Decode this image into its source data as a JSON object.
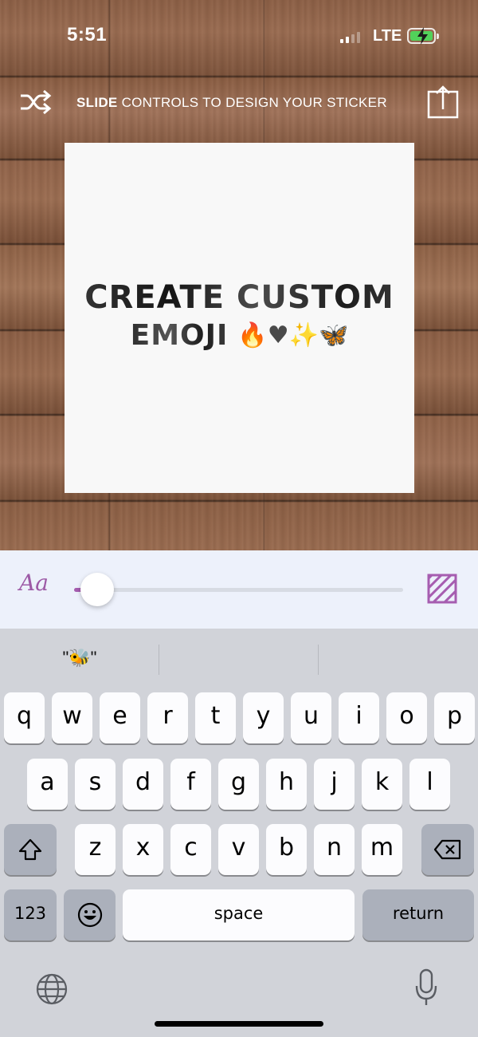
{
  "status_bar": {
    "time": "5:51",
    "network": "LTE",
    "battery_color": "#52d15a"
  },
  "top_bar": {
    "hint_bold": "SLIDE",
    "hint_rest": " CONTROLS TO DESIGN YOUR STICKER",
    "shuffle_icon": "shuffle-icon",
    "share_icon": "share-icon"
  },
  "sticker": {
    "line1": "CREATE CUSTOM",
    "line2": "EMOJI",
    "emoji": "🔥♥✨🦋"
  },
  "controls": {
    "font_icon_label": "Aa",
    "slider_value": 0.07,
    "accent_color": "#a65db0",
    "pattern_icon": "pattern-icon"
  },
  "keyboard": {
    "suggestions": [
      "\"🐝\"",
      "",
      ""
    ],
    "row1": [
      "q",
      "w",
      "e",
      "r",
      "t",
      "y",
      "u",
      "i",
      "o",
      "p"
    ],
    "row2": [
      "a",
      "s",
      "d",
      "f",
      "g",
      "h",
      "j",
      "k",
      "l"
    ],
    "row3": [
      "z",
      "x",
      "c",
      "v",
      "b",
      "n",
      "m"
    ],
    "numbers_label": "123",
    "space_label": "space",
    "return_label": "return"
  }
}
